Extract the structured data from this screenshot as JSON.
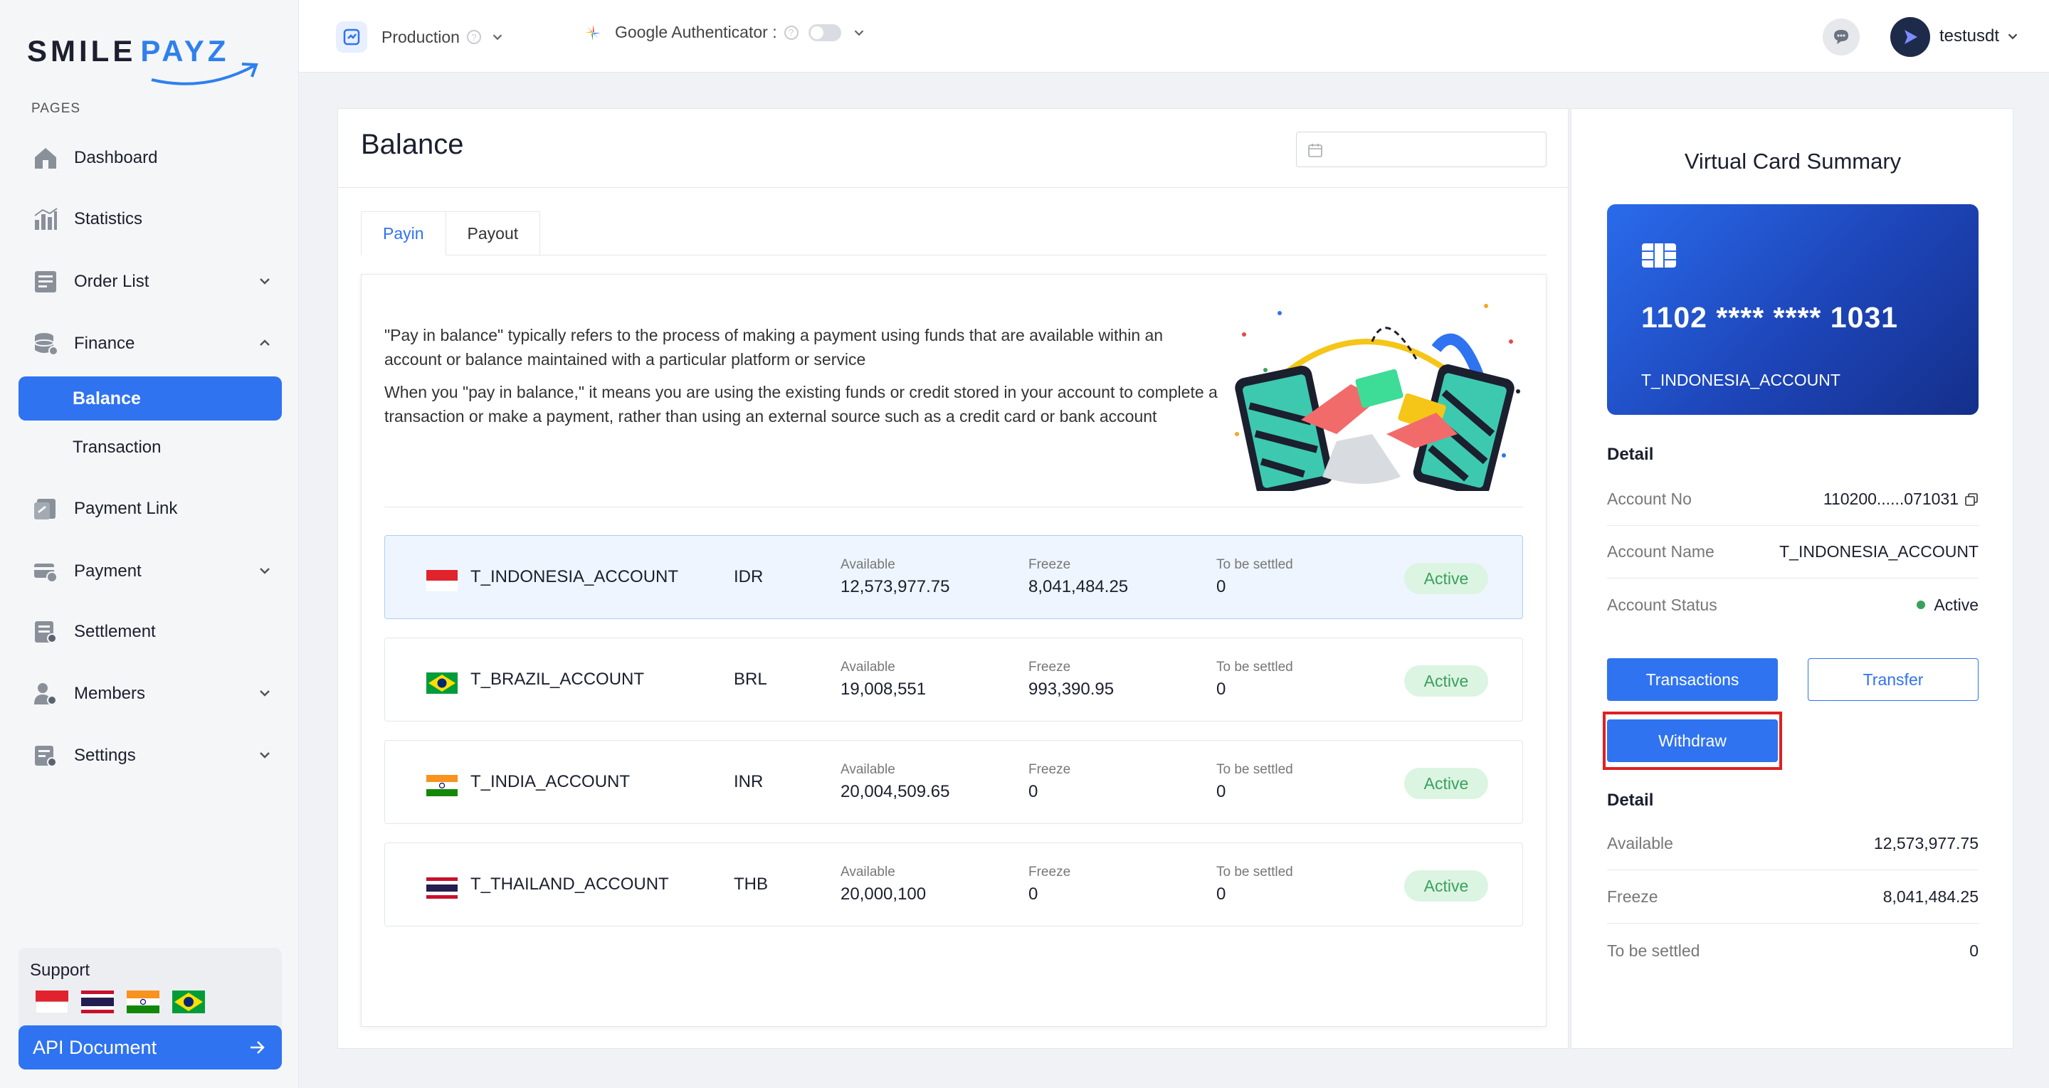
{
  "brand": {
    "name_part1": "SMILE",
    "name_part2": "PAYZ",
    "accent": "#2f73f0"
  },
  "sidebar": {
    "section_label": "PAGES",
    "items": [
      {
        "label": "Dashboard",
        "icon": "home-icon"
      },
      {
        "label": "Statistics",
        "icon": "chart-icon"
      },
      {
        "label": "Order List",
        "icon": "list-icon"
      },
      {
        "label": "Finance",
        "icon": "database-icon"
      },
      {
        "label": "Payment Link",
        "icon": "link-icon"
      },
      {
        "label": "Payment",
        "icon": "payment-icon"
      },
      {
        "label": "Settlement",
        "icon": "settlement-icon"
      },
      {
        "label": "Members",
        "icon": "members-icon"
      },
      {
        "label": "Settings",
        "icon": "settings-icon"
      }
    ],
    "finance_sub": {
      "active": "Balance",
      "other": "Transaction"
    },
    "support": {
      "title": "Support"
    },
    "api_button": "API Document"
  },
  "topbar": {
    "environment": "Production",
    "authenticator": "Google Authenticator :",
    "username": "testusdt"
  },
  "balance": {
    "title": "Balance",
    "tabs": [
      "Payin",
      "Payout"
    ],
    "description": [
      "\"Pay in balance\" typically refers to the process of making a payment using funds that are available within an account or balance maintained with a particular platform or service",
      "When you \"pay in balance,\" it means you are using the existing funds or credit stored in your account to complete a transaction or make a payment, rather than using an external source such as a credit card or bank account"
    ],
    "labels": {
      "available": "Available",
      "freeze": "Freeze",
      "settled": "To be settled"
    },
    "accounts": [
      {
        "name": "T_INDONESIA_ACCOUNT",
        "currency": "IDR",
        "available": "12,573,977.75",
        "freeze": "8,041,484.25",
        "settled": "0",
        "status": "Active"
      },
      {
        "name": "T_BRAZIL_ACCOUNT",
        "currency": "BRL",
        "available": "19,008,551",
        "freeze": "993,390.95",
        "settled": "0",
        "status": "Active"
      },
      {
        "name": "T_INDIA_ACCOUNT",
        "currency": "INR",
        "available": "20,004,509.65",
        "freeze": "0",
        "settled": "0",
        "status": "Active"
      },
      {
        "name": "T_THAILAND_ACCOUNT",
        "currency": "THB",
        "available": "20,000,100",
        "freeze": "0",
        "settled": "0",
        "status": "Active"
      }
    ]
  },
  "summary": {
    "title": "Virtual Card Summary",
    "card_number": "1102 **** **** 1031",
    "card_name": "T_INDONESIA_ACCOUNT",
    "detail_title": "Detail",
    "account_no_label": "Account No",
    "account_no": "110200......071031",
    "account_name_label": "Account Name",
    "account_name": "T_INDONESIA_ACCOUNT",
    "account_status_label": "Account Status",
    "account_status": "Active",
    "btn_transactions": "Transactions",
    "btn_transfer": "Transfer",
    "btn_withdraw": "Withdraw",
    "detail2_title": "Detail",
    "available_label": "Available",
    "available": "12,573,977.75",
    "freeze_label": "Freeze",
    "freeze": "8,041,484.25",
    "settled_label": "To be settled",
    "settled": "0"
  }
}
